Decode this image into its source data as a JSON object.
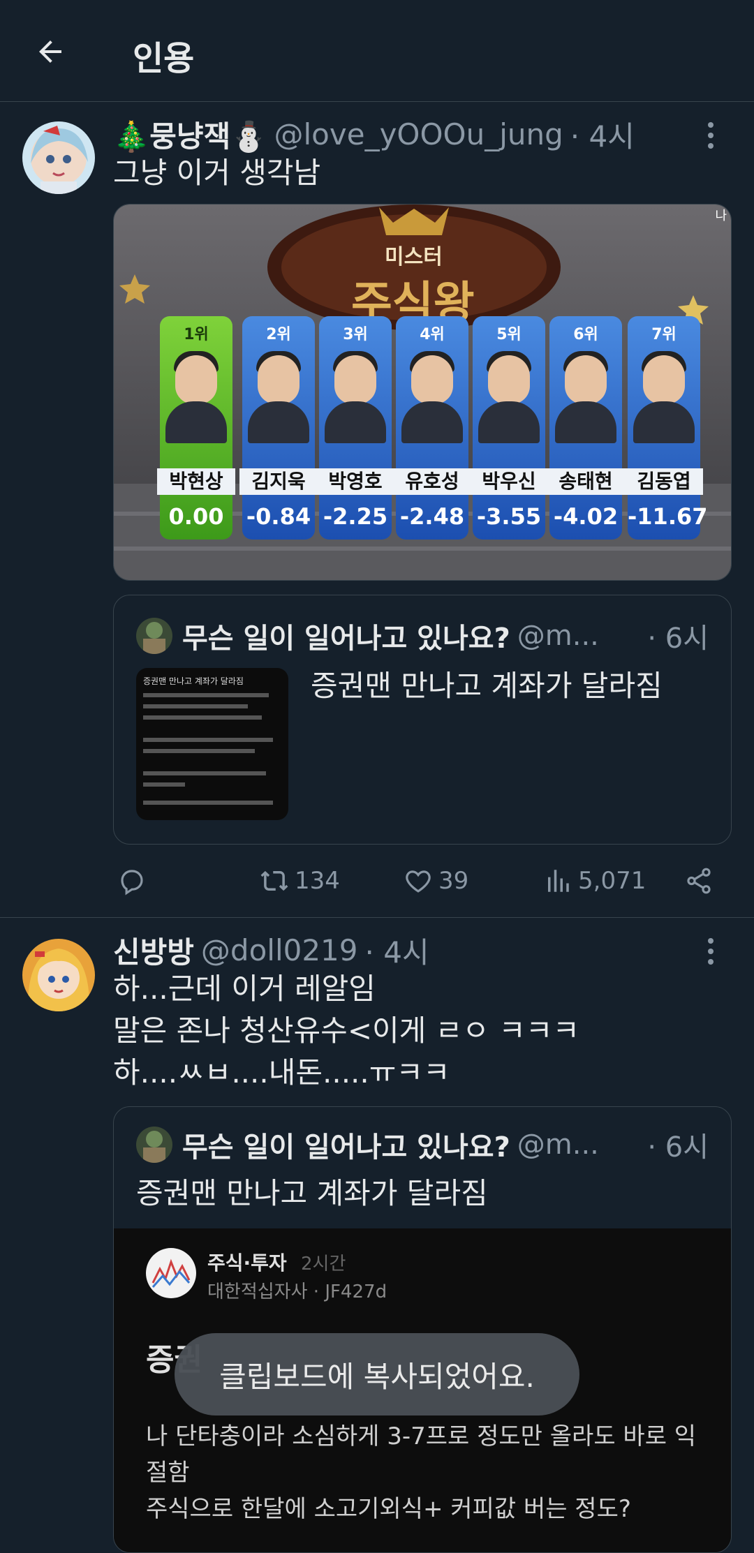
{
  "header": {
    "title": "인용"
  },
  "tweets": [
    {
      "name": "🎄뭉냥잭⛄",
      "handle": "@love_yOOOu_jung",
      "time": "· 4시",
      "text": "그냥 이거 생각남",
      "media": {
        "top_title": "미스터",
        "main_title": "주식왕",
        "corner": "나​",
        "ranks": [
          {
            "rank": "1위",
            "name": "박현상",
            "value": "0.00"
          },
          {
            "rank": "2위",
            "name": "김지욱",
            "value": "-0.84"
          },
          {
            "rank": "3위",
            "name": "박영호",
            "value": "-2.25"
          },
          {
            "rank": "4위",
            "name": "유호성",
            "value": "-2.48"
          },
          {
            "rank": "5위",
            "name": "박우신",
            "value": "-3.55"
          },
          {
            "rank": "6위",
            "name": "송태현",
            "value": "-4.02"
          },
          {
            "rank": "7위",
            "name": "김동엽",
            "value": "-11.67"
          }
        ],
        "percent": "%"
      },
      "quote": {
        "name": "무슨 일이 일어나고 있나요?",
        "handle": "@m...",
        "time": "· 6시",
        "text": "증권맨 만나고 계좌가 달라짐",
        "thumb_title": "증권맨 만나고 계좌가 달라짐"
      },
      "actions": {
        "retweets": "134",
        "likes": "39",
        "views": "5,071"
      }
    },
    {
      "name": "신방방",
      "handle": "@doll0219",
      "time": "· 4시",
      "lines": [
        "하...근데 이거 레알임",
        "말은 존나 청산유수<이게 ㄹㅇ ㅋㅋㅋ",
        "하....ㅆㅂ....내돈.....ㅠㅋㅋ"
      ],
      "quote": {
        "name": "무슨 일이 일어나고 있나요?",
        "handle": "@m...",
        "time": "· 6시",
        "text": "증권맨 만나고 계좌가 달라짐",
        "inner": {
          "board": "주식·투자",
          "board_time": "2시간",
          "company": "대한적십자사 · JF427d",
          "title_fragment": "증권",
          "body_lines": [
            "나 단타충이라 소심하게 3-7프로 정도만 올라도 바로 익",
            "절함",
            "주식으로 한달에 소고기외식+ 커피값 버는 정도?"
          ]
        }
      }
    }
  ],
  "toast": {
    "text": "클립보드에 복사되었어요."
  },
  "colors": {
    "background": "#15202b",
    "divider": "#38444d",
    "secondary_text": "#8b98a5",
    "toast": "#4a4f55"
  }
}
